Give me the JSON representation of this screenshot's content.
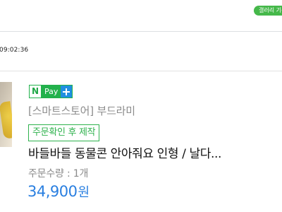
{
  "header": {
    "gallery_badge": "갤러리 기능설"
  },
  "order": {
    "time": "09:02:36",
    "thumbnail_icon": "product-thumbnail",
    "npay": {
      "n": "N",
      "pay": "Pay",
      "plus_icon": "plus-icon"
    },
    "store_name": "[스마트스토어] 부드라미",
    "custom_order_tag": "주문확인 후 제작",
    "product_title": "바들바들 동물콘 안아줘요 인형 / 날다...",
    "quantity_label": "주문수량 : 1개",
    "price_value": "34,900",
    "price_unit": "원"
  },
  "colors": {
    "green": "#2fb24d",
    "blue": "#2a7fe0",
    "gray": "#8c8c8c"
  }
}
